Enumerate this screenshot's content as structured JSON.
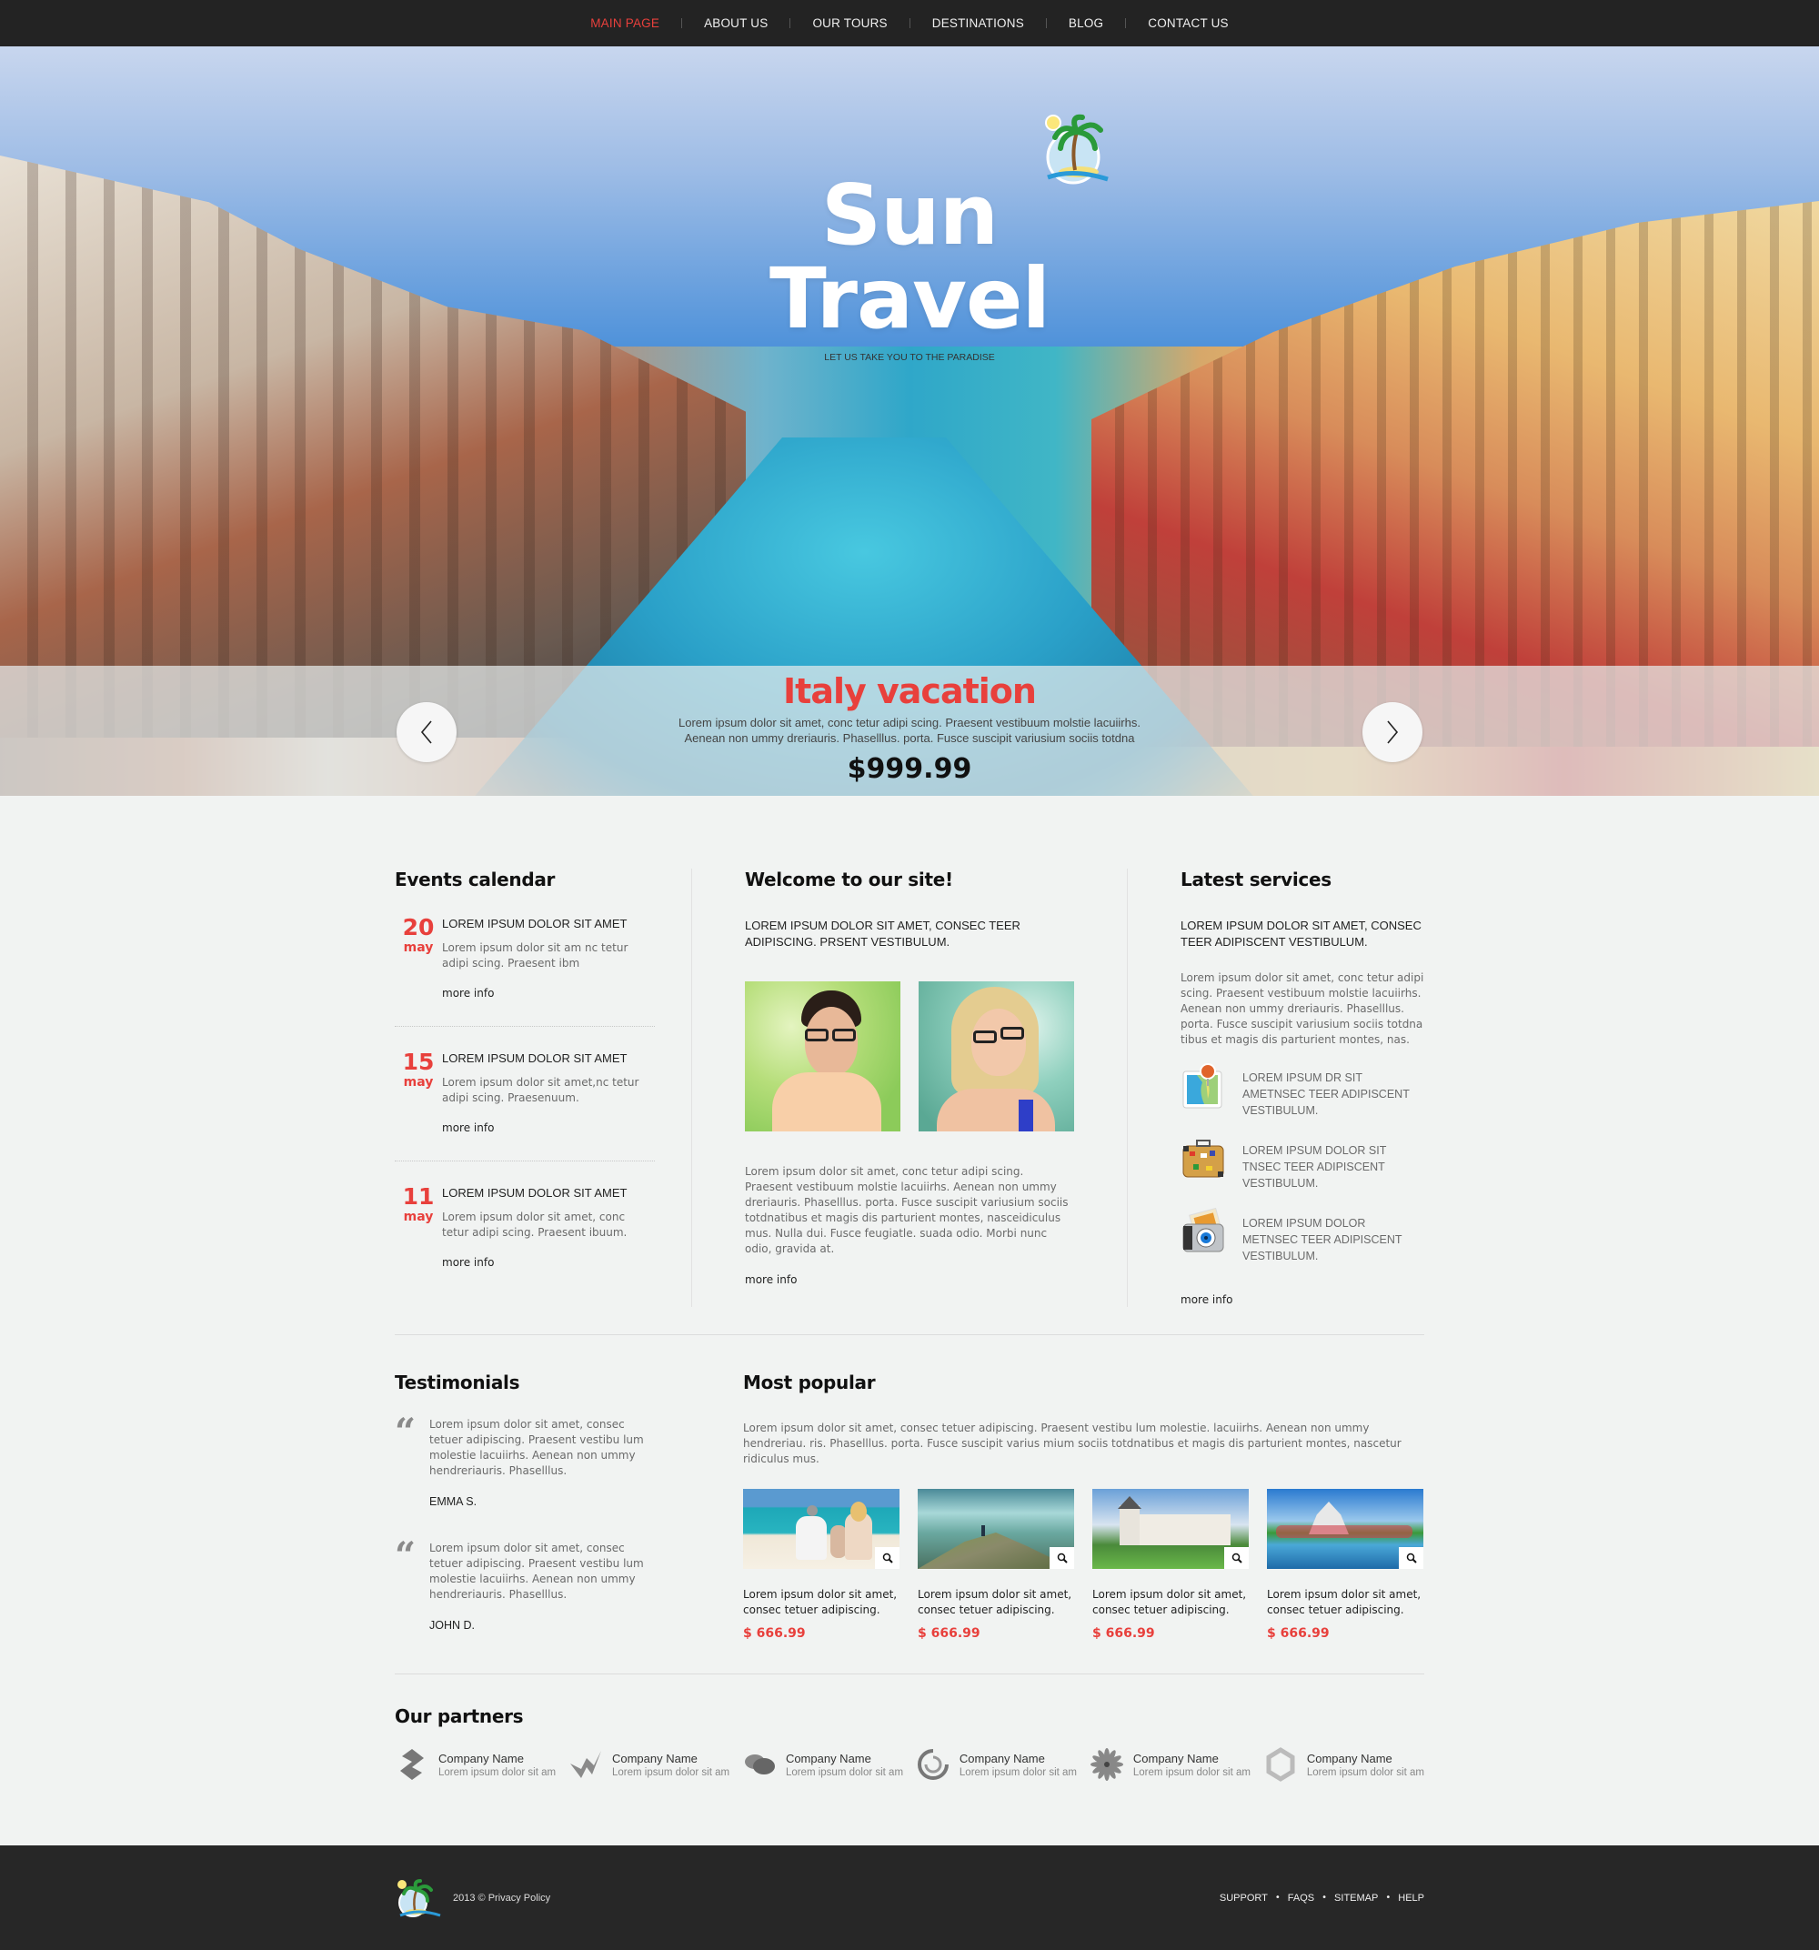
{
  "nav": {
    "items": [
      {
        "label": "MAIN PAGE",
        "active": true
      },
      {
        "label": "ABOUT US",
        "active": false
      },
      {
        "label": "OUR TOURS",
        "active": false
      },
      {
        "label": "DESTINATIONS",
        "active": false
      },
      {
        "label": "BLOG",
        "active": false
      },
      {
        "label": "CONTACT US",
        "active": false
      }
    ]
  },
  "brand": {
    "title": "Sun Travel",
    "tagline": "LET US TAKE YOU TO THE PARADISE",
    "logo_icon": "palm-island-icon"
  },
  "slider": {
    "title": "Italy vacation",
    "text_line1": "Lorem ipsum dolor sit amet, conc tetur adipi scing. Praesent vestibuum molstie lacuiirhs.",
    "text_line2": "Aenean non ummy dreriauris. Phaselllus. porta. Fusce suscipit variusium sociis totdna",
    "price": "$999.99",
    "prev_icon": "chevron-left-icon",
    "next_icon": "chevron-right-icon"
  },
  "events": {
    "title": "Events calendar",
    "items": [
      {
        "day": "20",
        "month": "may",
        "heading": "LOREM IPSUM DOLOR SIT AMET",
        "text": "Lorem ipsum dolor sit am nc tetur adipi scing. Praesent ibm",
        "link": "more info"
      },
      {
        "day": "15",
        "month": "may",
        "heading": "LOREM IPSUM DOLOR SIT AMET",
        "text": "Lorem ipsum dolor sit amet,nc tetur adipi scing. Praesenuum.",
        "link": "more info"
      },
      {
        "day": "11",
        "month": "may",
        "heading": "LOREM IPSUM DOLOR SIT AMET",
        "text": "Lorem ipsum dolor sit amet, conc tetur adipi scing. Praesent ibuum.",
        "link": "more info"
      }
    ]
  },
  "welcome": {
    "title": "Welcome to our site!",
    "intro": "LOREM IPSUM DOLOR SIT AMET, CONSEC TEER ADIPISCING. PRSENT VESTIBULUM.",
    "text": "Lorem ipsum dolor sit amet, conc tetur adipi scing. Praesent vestibuum molstie lacuiirhs. Aenean non ummy dreriauris. Phaselllus. porta. Fusce suscipit variusium sociis totdnatibus et magis dis parturient montes, nasceidiculus mus. Nulla dui. Fusce feugiatle. suada odio. Morbi nunc odio, gravida at.",
    "link": "more info"
  },
  "services": {
    "title": "Latest services",
    "intro": "LOREM IPSUM DOLOR SIT AMET, CONSEC TEER ADIPISCENT VESTIBULUM.",
    "text": "Lorem ipsum dolor sit amet, conc tetur adipi scing. Praesent vestibuum molstie lacuiirhs. Aenean non ummy dreriauris. Phaselllus. porta. Fusce suscipit variusium sociis totdna tibus et magis dis parturient montes, nas.",
    "items": [
      {
        "icon": "map-pin-icon",
        "text": "LOREM IPSUM DR SIT AMETNSEC TEER ADIPISCENT VESTIBULUM."
      },
      {
        "icon": "suitcase-icon",
        "text": "LOREM IPSUM DOLOR SIT TNSEC TEER ADIPISCENT VESTIBULUM."
      },
      {
        "icon": "camera-icon",
        "text": "LOREM IPSUM DOLOR METNSEC TEER ADIPISCENT VESTIBULUM."
      }
    ],
    "link": "more info"
  },
  "testimonials": {
    "title": "Testimonials",
    "items": [
      {
        "text": "Lorem ipsum dolor sit amet, consec tetuer adipiscing. Praesent vestibu lum molestie lacuiirhs. Aenean non ummy hendreriauris. Phaselllus.",
        "author": "EMMA S."
      },
      {
        "text": "Lorem ipsum dolor sit amet, consec tetuer adipiscing. Praesent vestibu lum molestie lacuiirhs. Aenean non ummy hendreriauris. Phaselllus.",
        "author": "JOHN D."
      }
    ]
  },
  "popular": {
    "title": "Most popular",
    "intro": "Lorem ipsum dolor sit amet, consec tetuer adipiscing. Praesent vestibu lum molestie. lacuiirhs. Aenean non ummy hendreriau. ris. Phaselllus. porta. Fusce suscipit varius mium sociis totdnatibus et magis dis parturient montes, nascetur ridiculus mus.",
    "items": [
      {
        "scene": "beach-family",
        "title": "Lorem ipsum dolor sit amet, consec tetuer adipiscing.",
        "price": "$ 666.99"
      },
      {
        "scene": "mountain-hiker",
        "title": "Lorem ipsum dolor sit amet, consec tetuer adipiscing.",
        "price": "$ 666.99"
      },
      {
        "scene": "castle-garden",
        "title": "Lorem ipsum dolor sit amet, consec tetuer adipiscing.",
        "price": "$ 666.99"
      },
      {
        "scene": "temple-lake",
        "title": "Lorem ipsum dolor sit amet, consec tetuer adipiscing.",
        "price": "$ 666.99"
      }
    ]
  },
  "partners": {
    "title": "Our partners",
    "items": [
      {
        "logo": "diamond-s-logo",
        "name": "Company Name",
        "desc": "Lorem ipsum dolor sit am"
      },
      {
        "logo": "folded-w-logo",
        "name": "Company Name",
        "desc": "Lorem ipsum dolor sit am"
      },
      {
        "logo": "speech-bubbles-logo",
        "name": "Company Name",
        "desc": "Lorem ipsum dolor sit am"
      },
      {
        "logo": "swirl-circle-logo",
        "name": "Company Name",
        "desc": "Lorem ipsum dolor sit am"
      },
      {
        "logo": "flower-logo",
        "name": "Company Name",
        "desc": "Lorem ipsum dolor sit am"
      },
      {
        "logo": "ring-logo",
        "name": "Company Name",
        "desc": "Lorem ipsum dolor sit am"
      }
    ]
  },
  "footer": {
    "copyright": "2013 © Privacy Policy",
    "links": [
      "SUPPORT",
      "FAQS",
      "SITEMAP",
      "HELP"
    ]
  },
  "colors": {
    "accent": "#e8403c",
    "nav_bg": "#232323",
    "footer_bg": "#272727",
    "page_bg": "#f1f3f2"
  }
}
